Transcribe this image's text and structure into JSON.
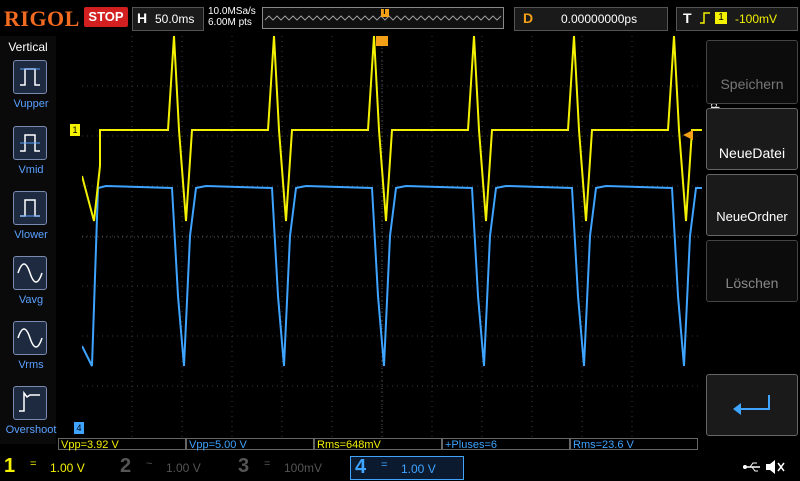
{
  "top": {
    "brand": "RIGOL",
    "run_state": "STOP",
    "timebase_key": "H",
    "timebase_value": "50.0ms",
    "sample_rate": "10.0MSa/s",
    "memory_depth": "6.00M pts",
    "delay_key": "D",
    "delay_value": "0.00000000ps",
    "trigger_key": "T",
    "trigger_level": "-100mV",
    "trigger_marker": "T"
  },
  "left_panel": {
    "title": "Vertical",
    "items": [
      {
        "label": "Vupper"
      },
      {
        "label": "Vmid"
      },
      {
        "label": "Vlower"
      },
      {
        "label": "Vavg"
      },
      {
        "label": "Vrms"
      },
      {
        "label": "Overshoot"
      }
    ]
  },
  "right_panel": {
    "title": "Speichern",
    "buttons": [
      {
        "label": "Speichern"
      },
      {
        "label": "NeueDatei"
      },
      {
        "label": "NeueOrdner"
      },
      {
        "label": "Löschen"
      }
    ]
  },
  "plot": {
    "ch1_marker": "1",
    "ch4_marker": "4"
  },
  "measurements": [
    {
      "label": "Vpp=3.92 V",
      "color": "#f3f000"
    },
    {
      "label": "Vpp=5.00 V",
      "color": "#3ea4ff"
    },
    {
      "label": "Rms=648mV",
      "color": "#f3f000"
    },
    {
      "label": "+Pluses=6",
      "color": "#3ea4ff"
    },
    {
      "label": "Rms=23.6 V",
      "color": "#3ea4ff"
    }
  ],
  "channels": [
    {
      "number": "1",
      "coupling": "=",
      "scale": "1.00 V",
      "color": "#f3f000"
    },
    {
      "number": "2",
      "coupling": "~",
      "scale": "1.00 V",
      "color": "#22a8a8"
    },
    {
      "number": "3",
      "coupling": "=",
      "scale": "100mV",
      "color": "#c030c0"
    },
    {
      "number": "4",
      "coupling": "=",
      "scale": "1.00 V",
      "color": "#3ea4ff"
    }
  ],
  "colors": {
    "brand": "#f36b20",
    "stop": "#d21f1f",
    "ch1": "#f3f000",
    "ch4": "#3ea4ff",
    "trigger": "#f3a016"
  },
  "icons": [
    "usb-icon",
    "speaker-mute-icon",
    "return-arrow-icon"
  ]
}
